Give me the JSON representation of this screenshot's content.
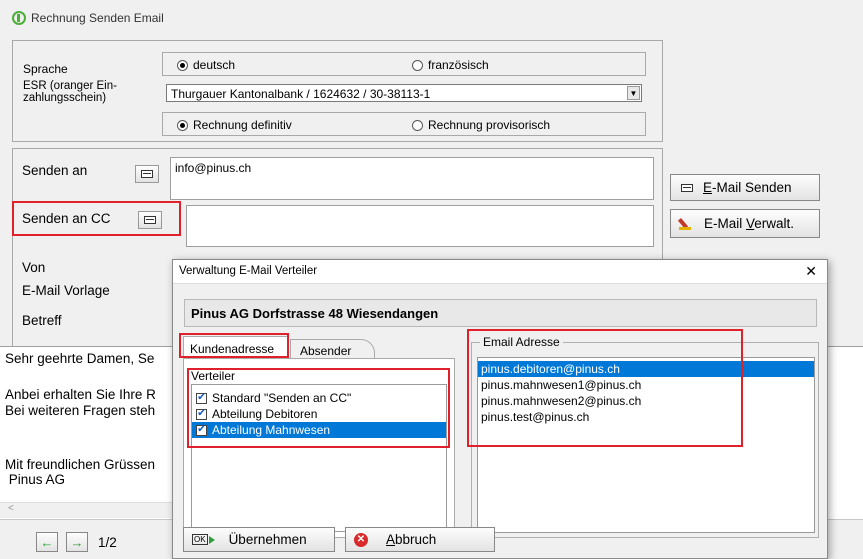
{
  "window": {
    "title": "Rechnung Senden Email"
  },
  "settings": {
    "sprache_label": "Sprache",
    "lang_deutsch": "deutsch",
    "lang_franz": "französisch",
    "esr_label": "ESR (oranger Ein-zahlungsschein)",
    "esr_value": "Thurgauer Kantonalbank / 1624632 / 30-38113-1",
    "rechnung_definitiv": "Rechnung definitiv",
    "rechnung_provisorisch": "Rechnung provisorisch"
  },
  "form": {
    "senden_an_label": "Senden an",
    "senden_an_value": "info@pinus.ch",
    "senden_an_cc_label": "Senden an CC",
    "senden_an_cc_value": "",
    "von_label": "Von",
    "vorlage_label": "E-Mail Vorlage",
    "betreff_label": "Betreff"
  },
  "actions": {
    "email_senden_prefix": "E",
    "email_senden_rest": "-Mail Senden",
    "email_verwalt_prefix": "E-Mail ",
    "email_verwalt_u": "V",
    "email_verwalt_rest": "erwalt."
  },
  "body": {
    "l1": "Sehr geehrte Damen, Se",
    "l2": "Anbei erhalten Sie Ihre R",
    "l3": "Bei weiteren Fragen steh",
    "l4": "Mit freundlichen Grüssen",
    "l5": " Pinus AG"
  },
  "nav": {
    "page": "1/2"
  },
  "dialog": {
    "title": "Verwaltung E-Mail Verteiler",
    "address": "Pinus AG Dorfstrasse 48 Wiesendangen",
    "tabs": [
      "Kundenadresse",
      "Absender"
    ],
    "verteiler_label": "Verteiler",
    "verteiler": [
      {
        "label": "Standard \"Senden an CC\"",
        "checked": true,
        "selected": false
      },
      {
        "label": "Abteilung Debitoren",
        "checked": true,
        "selected": false
      },
      {
        "label": "Abteilung Mahnwesen",
        "checked": true,
        "selected": true
      }
    ],
    "email_label": "Email Adresse",
    "emails": [
      {
        "value": "pinus.debitoren@pinus.ch",
        "selected": true
      },
      {
        "value": "pinus.mahnwesen1@pinus.ch",
        "selected": false
      },
      {
        "value": "pinus.mahnwesen2@pinus.ch",
        "selected": false
      },
      {
        "value": "pinus.test@pinus.ch",
        "selected": false
      }
    ],
    "uebernehmen": "Übernehmen",
    "ok_badge": "OK",
    "abbruch_u": "A",
    "abbruch_rest": "bbruch",
    "close_glyph": "✕"
  },
  "colors": {
    "highlight": "#e0202a",
    "selection": "#0078d7"
  }
}
